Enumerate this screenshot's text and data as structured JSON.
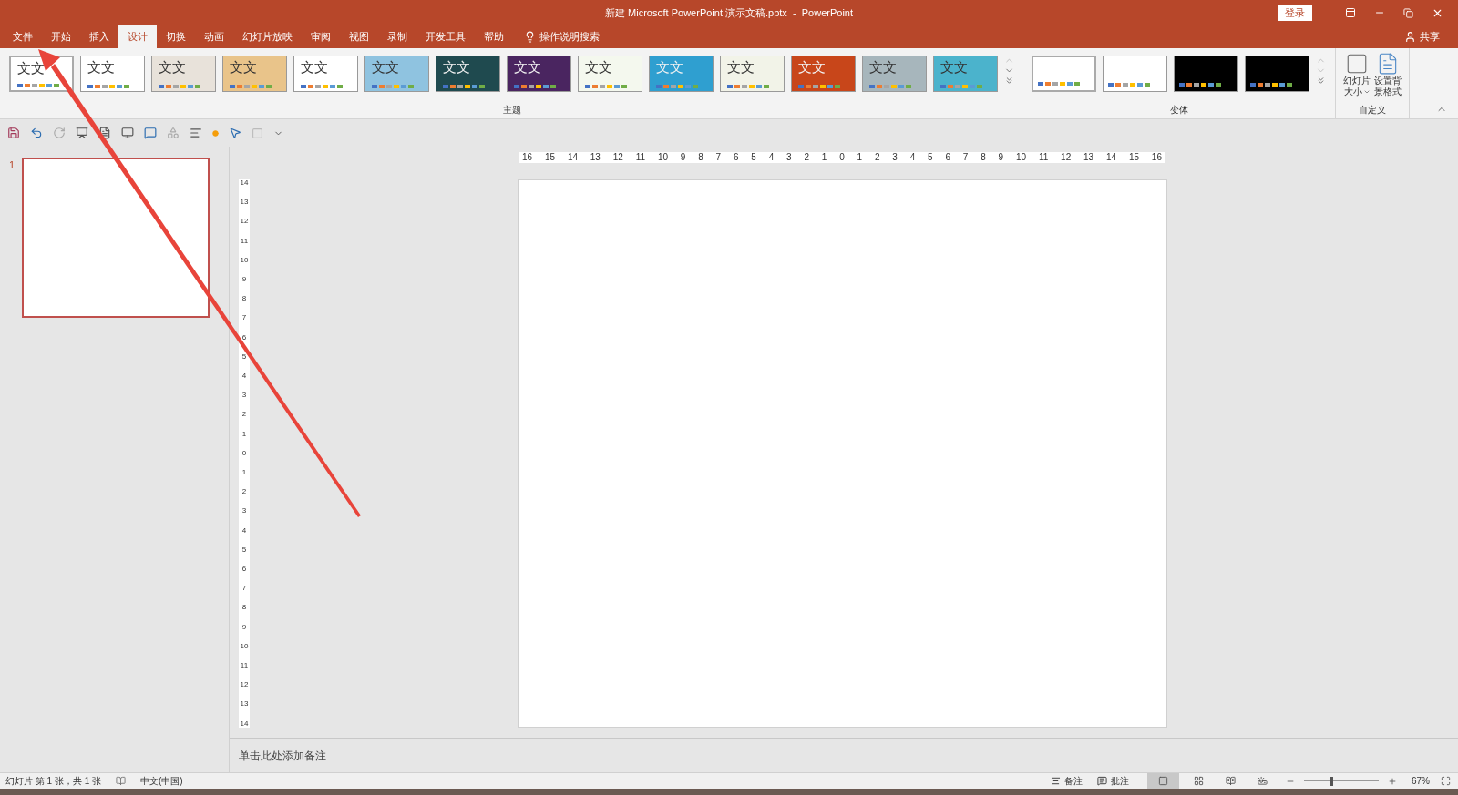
{
  "window": {
    "title": "新建 Microsoft PowerPoint 演示文稿.pptx  -  PowerPoint",
    "sign_in": "登录"
  },
  "tabs": [
    {
      "label": "文件",
      "selected": false
    },
    {
      "label": "开始",
      "selected": false
    },
    {
      "label": "插入",
      "selected": false
    },
    {
      "label": "设计",
      "selected": true
    },
    {
      "label": "切换",
      "selected": false
    },
    {
      "label": "动画",
      "selected": false
    },
    {
      "label": "幻灯片放映",
      "selected": false
    },
    {
      "label": "审阅",
      "selected": false
    },
    {
      "label": "视图",
      "selected": false
    },
    {
      "label": "录制",
      "selected": false
    },
    {
      "label": "开发工具",
      "selected": false
    },
    {
      "label": "帮助",
      "selected": false
    }
  ],
  "tell_me": "操作说明搜索",
  "share": "共享",
  "themes": {
    "label": "主题",
    "items": [
      {
        "text": "文文",
        "color": "#ffffff",
        "selected": true
      },
      {
        "text": "文文",
        "color": "#ffffff",
        "selected": false
      },
      {
        "text": "文文",
        "color": "#e8e2da",
        "selected": false
      },
      {
        "text": "文文",
        "color": "#e9c48a",
        "selected": false
      },
      {
        "text": "文文",
        "color": "#ffffff",
        "selected": false
      },
      {
        "text": "文文",
        "color": "#8fc3e0",
        "selected": false
      },
      {
        "text": "文文",
        "color": "#1f4a4f",
        "selected": false
      },
      {
        "text": "文文",
        "color": "#4a2560",
        "selected": false
      },
      {
        "text": "文文",
        "color": "#f4f8ee",
        "selected": false
      },
      {
        "text": "文文",
        "color": "#2f9fd0",
        "selected": false
      },
      {
        "text": "文文",
        "color": "#f2f3e8",
        "selected": false
      },
      {
        "text": "文文",
        "color": "#c8461a",
        "selected": false
      },
      {
        "text": "文文",
        "color": "#a7b6bc",
        "selected": false
      },
      {
        "text": "文文",
        "color": "#4bb3cc",
        "selected": false
      }
    ]
  },
  "variants": {
    "label": "变体",
    "items": [
      {
        "color": "#ffffff",
        "selected": true
      },
      {
        "color": "#ffffff",
        "selected": false
      },
      {
        "color": "#000000",
        "selected": false
      },
      {
        "color": "#000000",
        "selected": false
      }
    ]
  },
  "customize": {
    "label": "自定义",
    "buttons": [
      {
        "line1": "幻灯片",
        "line2": "大小",
        "dropdown": true
      },
      {
        "line1": "设置背",
        "line2": "景格式",
        "dropdown": false
      }
    ]
  },
  "thumbnails": [
    {
      "number": "1",
      "selected": true
    }
  ],
  "ruler_h": [
    "16",
    "15",
    "14",
    "13",
    "12",
    "11",
    "10",
    "9",
    "8",
    "7",
    "6",
    "5",
    "4",
    "3",
    "2",
    "1",
    "0",
    "1",
    "2",
    "3",
    "4",
    "5",
    "6",
    "7",
    "8",
    "9",
    "10",
    "11",
    "12",
    "13",
    "14",
    "15",
    "16"
  ],
  "ruler_v": [
    "14",
    "13",
    "12",
    "11",
    "10",
    "9",
    "8",
    "7",
    "6",
    "5",
    "4",
    "3",
    "2",
    "1",
    "0",
    "1",
    "2",
    "3",
    "4",
    "5",
    "6",
    "7",
    "8",
    "9",
    "10",
    "11",
    "12",
    "13",
    "14"
  ],
  "notes_placeholder": "单击此处添加备注",
  "status_bar": {
    "slide": "幻灯片 第 1 张，共 1 张",
    "language": "中文(中国)",
    "notes": "备注",
    "comments": "批注",
    "zoom": {
      "level": 0.37,
      "reading": "67%"
    }
  }
}
